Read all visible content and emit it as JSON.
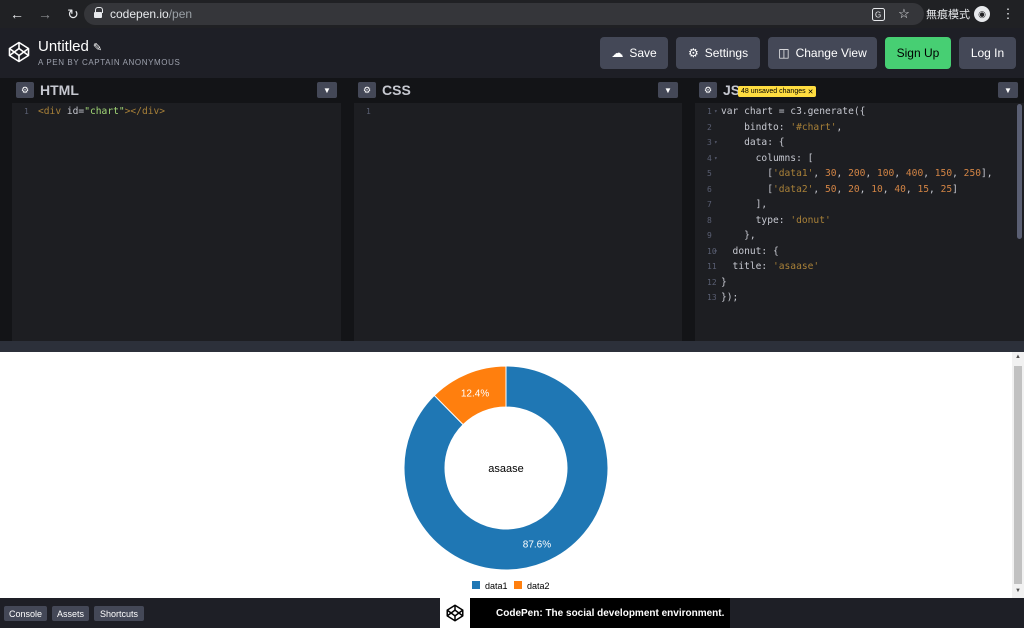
{
  "browser": {
    "url_host": "codepen.io",
    "url_path": "/pen",
    "incognito_label": "無痕模式",
    "translate_icon": "translate-icon",
    "bookmark_icon": "star-icon"
  },
  "header": {
    "title": "Untitled",
    "subtitle": "A PEN BY CAPTAIN ANONYMOUS",
    "save_label": "Save",
    "settings_label": "Settings",
    "change_view_label": "Change View",
    "signup_label": "Sign Up",
    "login_label": "Log In"
  },
  "editors": {
    "html": {
      "title": "HTML",
      "lines": [
        {
          "n": "1",
          "tag_open": "<div",
          "attr": " id=",
          "str": "\"chart\"",
          "tag_close": "></div>"
        }
      ]
    },
    "css": {
      "title": "CSS",
      "lines": [
        {
          "n": "1"
        }
      ]
    },
    "js": {
      "title": "JS",
      "unsaved": "48 unsaved changes",
      "lines": [
        {
          "n": "1",
          "fold": true,
          "text": "var chart = c3.generate({"
        },
        {
          "n": "2",
          "fold": false,
          "text": "    bindto: '#chart',"
        },
        {
          "n": "3",
          "fold": true,
          "text": "    data: {"
        },
        {
          "n": "4",
          "fold": true,
          "text": "      columns: ["
        },
        {
          "n": "5",
          "fold": false,
          "text": "        ['data1', 30, 200, 100, 400, 150, 250],"
        },
        {
          "n": "6",
          "fold": false,
          "text": "        ['data2', 50, 20, 10, 40, 15, 25]"
        },
        {
          "n": "7",
          "fold": false,
          "text": "      ],"
        },
        {
          "n": "8",
          "fold": false,
          "text": "      type: 'donut'"
        },
        {
          "n": "9",
          "fold": false,
          "text": "    },"
        },
        {
          "n": "10",
          "fold": true,
          "text": "  donut: {"
        },
        {
          "n": "11",
          "fold": false,
          "text": "  title: 'asaase'"
        },
        {
          "n": "12",
          "fold": false,
          "text": "}"
        },
        {
          "n": "13",
          "fold": false,
          "text": "});"
        }
      ]
    }
  },
  "chart_data": {
    "type": "pie",
    "title": "asaase",
    "series": [
      {
        "name": "data1",
        "value": 1130,
        "percent_label": "87.6%",
        "color": "#1f77b4"
      },
      {
        "name": "data2",
        "value": 160,
        "percent_label": "12.4%",
        "color": "#ff7f0e"
      }
    ],
    "legend_position": "bottom"
  },
  "footer": {
    "console_label": "Console",
    "assets_label": "Assets",
    "shortcuts_label": "Shortcuts",
    "toast_text": "CodePen: The social development environment."
  }
}
